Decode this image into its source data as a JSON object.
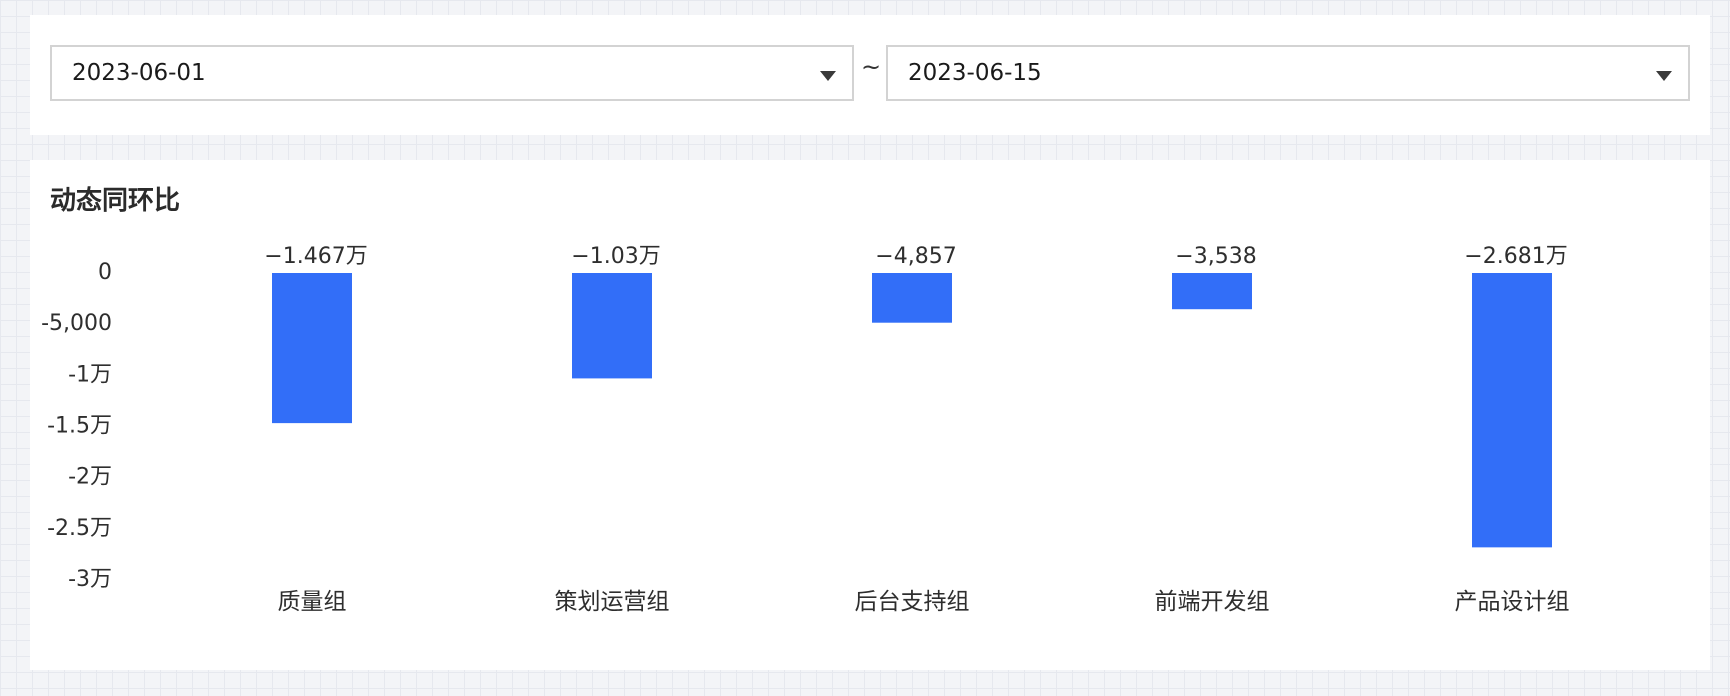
{
  "filters": {
    "start_date": "2023-06-01",
    "separator": "~",
    "end_date": "2023-06-15"
  },
  "icons": {
    "dropdown": "caret-down-icon"
  },
  "colors": {
    "bar": "#326ef8",
    "panel": "#ffffff",
    "page": "#f3f4f7"
  },
  "chart_data": {
    "type": "bar",
    "title": "动态同环比",
    "xlabel": "",
    "ylabel": "",
    "categories": [
      "质量组",
      "策划运营组",
      "后台支持组",
      "前端开发组",
      "产品设计组"
    ],
    "values": [
      -14670,
      -10300,
      -4857,
      -3538,
      -26810
    ],
    "data_labels": [
      "−1.467万",
      "−1.03万",
      "−4,857",
      "−3,538",
      "−2.681万"
    ],
    "ylim": [
      -30000,
      0
    ],
    "y_ticks": [
      0,
      -5000,
      -10000,
      -15000,
      -20000,
      -25000,
      -30000
    ],
    "y_tick_labels": [
      "0",
      "-5,000",
      "-1万",
      "-1.5万",
      "-2万",
      "-2.5万",
      "-3万"
    ],
    "grid": false,
    "legend": "none"
  }
}
